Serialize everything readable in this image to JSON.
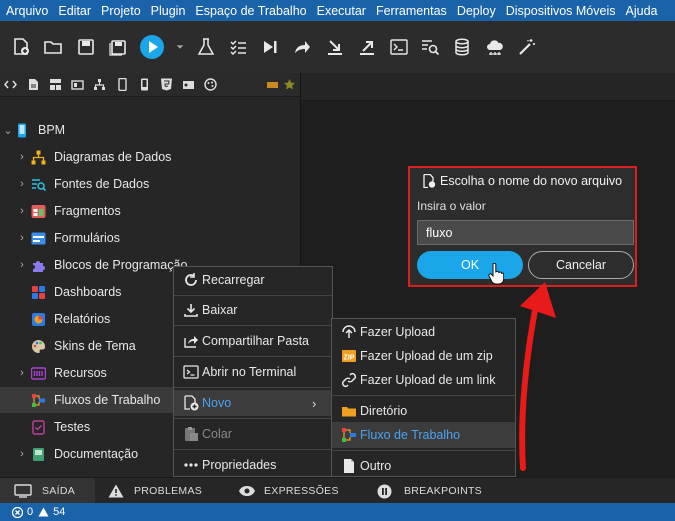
{
  "menubar": {
    "items": [
      "Arquivo",
      "Editar",
      "Projeto",
      "Plugin",
      "Espaço de Trabalho",
      "Executar",
      "Ferramentas",
      "Deploy",
      "Dispositivos Móveis",
      "Ajuda"
    ]
  },
  "toolbar": {
    "icons": [
      "new-file-icon",
      "open-folder-icon",
      "save-icon",
      "save-all-icon",
      "run-icon",
      "run-dropdown-icon",
      "test-icon",
      "checklist-icon",
      "step-icon",
      "share-icon",
      "download-icon",
      "upload-icon",
      "terminal-icon",
      "inspect-icon",
      "database-icon",
      "cloud-icon",
      "magic-wand-icon"
    ]
  },
  "tree": {
    "root": "BPM",
    "items": [
      {
        "label": "Diagramas de Dados",
        "icon": "diagram-icon",
        "expandable": true
      },
      {
        "label": "Fontes de Dados",
        "icon": "datasource-icon",
        "expandable": true
      },
      {
        "label": "Fragmentos",
        "icon": "fragments-icon",
        "expandable": true
      },
      {
        "label": "Formulários",
        "icon": "forms-icon",
        "expandable": true
      },
      {
        "label": "Blocos de Programação",
        "icon": "blocks-icon",
        "expandable": true
      },
      {
        "label": "Dashboards",
        "icon": "dashboards-icon",
        "expandable": false
      },
      {
        "label": "Relatórios",
        "icon": "reports-icon",
        "expandable": false
      },
      {
        "label": "Skins de Tema",
        "icon": "palette-icon",
        "expandable": false
      },
      {
        "label": "Recursos",
        "icon": "resources-icon",
        "expandable": true
      },
      {
        "label": "Fluxos de Trabalho",
        "icon": "workflow-icon",
        "expandable": false
      },
      {
        "label": "Testes",
        "icon": "tests-icon",
        "expandable": false
      },
      {
        "label": "Documentação",
        "icon": "docs-icon",
        "expandable": true
      }
    ]
  },
  "context_menu": {
    "items": [
      {
        "label": "Recarregar",
        "icon": "reload-icon"
      },
      {
        "label": "Baixar",
        "icon": "download-icon"
      },
      {
        "label": "Compartilhar Pasta",
        "icon": "share-icon"
      },
      {
        "label": "Abrir no Terminal",
        "icon": "terminal-icon"
      },
      {
        "label": "Novo",
        "icon": "new-icon"
      },
      {
        "label": "Colar",
        "icon": "paste-icon"
      },
      {
        "label": "Propriedades",
        "icon": "more-icon"
      }
    ]
  },
  "submenu": {
    "items": [
      {
        "label": "Fazer Upload",
        "icon": "upload-icon"
      },
      {
        "label": "Fazer Upload de um zip",
        "icon": "zip-icon"
      },
      {
        "label": "Fazer Upload de um link",
        "icon": "link-icon"
      },
      {
        "label": "Diretório",
        "icon": "folder-icon"
      },
      {
        "label": "Fluxo de Trabalho",
        "icon": "workflow-icon"
      },
      {
        "label": "Outro",
        "icon": "file-icon"
      }
    ]
  },
  "dialog": {
    "title": "Escolha o nome do novo arquivo",
    "label": "Insira o valor",
    "value": "fluxo",
    "ok": "OK",
    "cancel": "Cancelar"
  },
  "bottom_tabs": [
    "SAÍDA",
    "PROBLEMAS",
    "EXPRESSÕES",
    "BREAKPOINTS"
  ],
  "status": {
    "errors": "0",
    "warnings": "54"
  },
  "colors": {
    "accent": "#1a63a8",
    "ok_button": "#1aa6e8",
    "highlight": "#d92020",
    "link_text": "#4aa3f0"
  }
}
